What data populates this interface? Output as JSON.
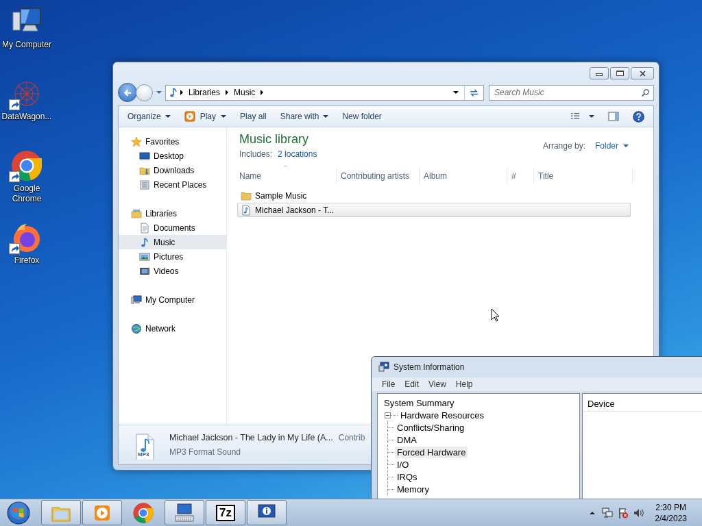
{
  "desktop_icons": [
    {
      "label": "My Computer",
      "kind": "computer",
      "shortcut": false
    },
    {
      "label": "DataWagon...",
      "kind": "graph",
      "shortcut": true
    },
    {
      "label": "Google Chrome",
      "kind": "chrome",
      "shortcut": true
    },
    {
      "label": "Firefox",
      "kind": "firefox",
      "shortcut": true
    }
  ],
  "explorer": {
    "breadcrumb": [
      "Libraries",
      "Music"
    ],
    "search": {
      "placeholder": "Search Music"
    },
    "toolbar": [
      {
        "label": "Organize",
        "kind": "menu"
      },
      {
        "label": "Play",
        "kind": "play"
      },
      {
        "label": "Play all",
        "kind": "plain"
      },
      {
        "label": "Share with",
        "kind": "menu"
      },
      {
        "label": "New folder",
        "kind": "plain"
      }
    ],
    "nav": [
      {
        "label": "Favorites",
        "kind": "star",
        "selected": false,
        "children": [
          {
            "label": "Desktop",
            "kind": "desktop",
            "selected": false
          },
          {
            "label": "Downloads",
            "kind": "downloads",
            "selected": false
          },
          {
            "label": "Recent Places",
            "kind": "recent",
            "selected": false
          }
        ]
      },
      {
        "label": "Libraries",
        "kind": "libraries",
        "selected": false,
        "children": [
          {
            "label": "Documents",
            "kind": "documents",
            "selected": false
          },
          {
            "label": "Music",
            "kind": "music",
            "selected": true
          },
          {
            "label": "Pictures",
            "kind": "pictures",
            "selected": false
          },
          {
            "label": "Videos",
            "kind": "videos",
            "selected": false
          }
        ]
      },
      {
        "label": "My Computer",
        "kind": "computer",
        "selected": false
      },
      {
        "label": "Network",
        "kind": "network",
        "selected": false
      }
    ],
    "library": {
      "title": "Music library",
      "includes_label": "Includes:",
      "includes_link": "2 locations",
      "arrange_label": "Arrange by:",
      "arrange_value": "Folder"
    },
    "columns": [
      "Name",
      "Contributing artists",
      "Album",
      "#",
      "Title"
    ],
    "rows": [
      {
        "name": "Sample Music",
        "kind": "folder",
        "selected": false
      },
      {
        "name": "Michael Jackson - T...",
        "kind": "audio",
        "selected": true
      }
    ],
    "details": {
      "file_icon_label": "MP3",
      "title": "Michael Jackson - The Lady in My Life (A...",
      "type": "MP3 Format Sound",
      "column_3": "Contrib"
    }
  },
  "system_information": {
    "title": "System Information",
    "menu": [
      "File",
      "Edit",
      "View",
      "Help"
    ],
    "tree": [
      {
        "label": "System Summary",
        "selected": false,
        "children": [
          {
            "label": "Hardware Resources",
            "expanded": true,
            "selected": false,
            "children": [
              {
                "label": "Conflicts/Sharing",
                "selected": false
              },
              {
                "label": "DMA",
                "selected": false
              },
              {
                "label": "Forced Hardware",
                "selected": true
              },
              {
                "label": "I/O",
                "selected": false
              },
              {
                "label": "IRQs",
                "selected": false
              },
              {
                "label": "Memory",
                "selected": false
              }
            ]
          }
        ]
      }
    ],
    "columns": [
      "Device"
    ]
  },
  "taskbar": {
    "items": [
      {
        "kind": "explorer",
        "running": true
      },
      {
        "kind": "media",
        "running": true
      },
      {
        "kind": "chrome",
        "running": false
      },
      {
        "kind": "keyboard",
        "running": true
      },
      {
        "kind": "archive",
        "label": "7z",
        "running": true
      },
      {
        "kind": "sysinfo",
        "running": true
      }
    ],
    "time": "2:30 PM",
    "date": "2/4/2023"
  }
}
